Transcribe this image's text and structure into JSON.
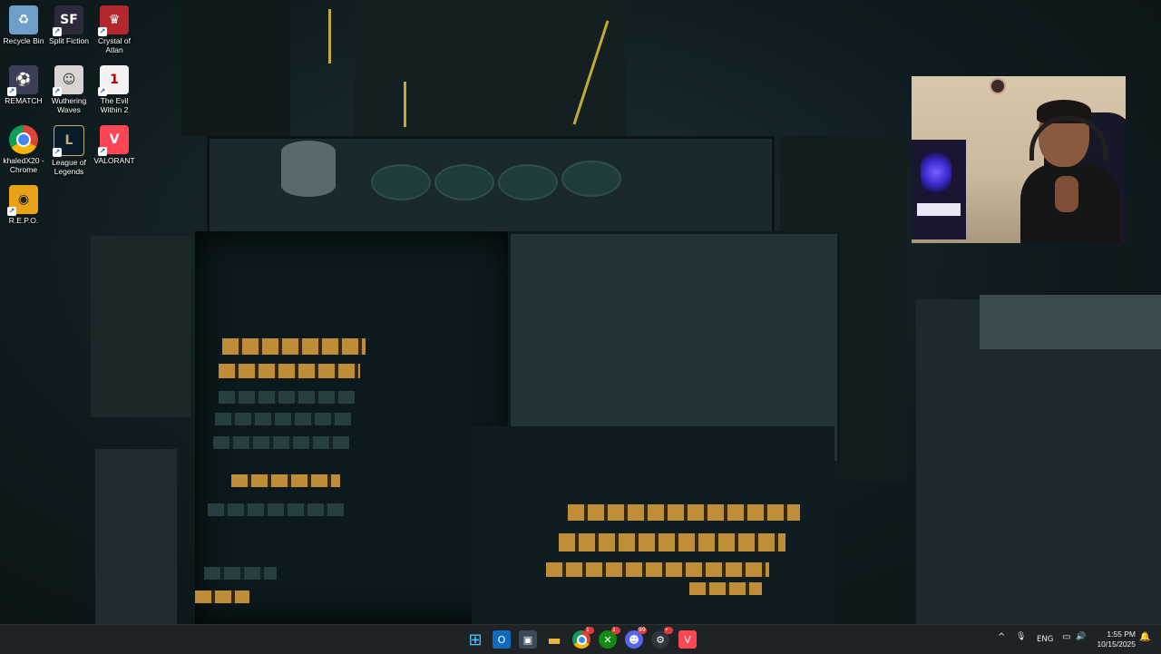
{
  "desktop_icons": [
    {
      "label": "Recycle Bin",
      "icon": "recycle-bin-icon",
      "color": "#6f9fc9",
      "glyph": "♻"
    },
    {
      "label": "Split Fiction",
      "icon": "split-fiction-icon",
      "color": "#2a2a3a",
      "glyph": "SF"
    },
    {
      "label": "Crystal of Atlan",
      "icon": "crystal-of-atlan-icon",
      "color": "#b3282d",
      "glyph": "♛"
    },
    {
      "label": "REMATCH",
      "icon": "rematch-icon",
      "color": "#3a3f55",
      "glyph": "⚽"
    },
    {
      "label": "Wuthering Waves",
      "icon": "wuthering-waves-icon",
      "color": "#d8d4d2",
      "glyph": "☺"
    },
    {
      "label": "The Evil Within 2",
      "icon": "evil-within-2-icon",
      "color": "#f2f2f2",
      "glyph": "1"
    },
    {
      "label": "khaledX20 - Chrome",
      "icon": "chrome-icon",
      "color": "#dd4b39",
      "glyph": "●"
    },
    {
      "label": "League of Legends",
      "icon": "league-of-legends-icon",
      "color": "#0a1c2a",
      "glyph": "L"
    },
    {
      "label": "VALORANT",
      "icon": "valorant-icon",
      "color": "#ff4655",
      "glyph": "V"
    },
    {
      "label": "R.E.P.O.",
      "icon": "repo-icon",
      "color": "#e7a21a",
      "glyph": "◉"
    }
  ],
  "taskbar": {
    "apps": [
      {
        "name": "start-button",
        "icon": "windows-start-icon",
        "color": "#2a8ae6",
        "glyph": "⊞",
        "badge": ""
      },
      {
        "name": "outlook-taskbar-button",
        "icon": "outlook-icon",
        "color": "#0f6cbd",
        "glyph": "O",
        "badge": ""
      },
      {
        "name": "store-taskbar-button",
        "icon": "microsoft-store-icon",
        "color": "#3b4a56",
        "glyph": "▣",
        "badge": ""
      },
      {
        "name": "file-explorer-taskbar-button",
        "icon": "file-explorer-icon",
        "color": "#e8b83a",
        "glyph": "▬",
        "badge": ""
      },
      {
        "name": "chrome-taskbar-button",
        "icon": "chrome-icon",
        "color": "#3a9a4a",
        "glyph": "●",
        "badge": "1"
      },
      {
        "name": "xbox-taskbar-button",
        "icon": "xbox-icon",
        "color": "#138a13",
        "glyph": "✕",
        "badge": "1"
      },
      {
        "name": "discord-taskbar-button",
        "icon": "discord-icon",
        "color": "#5865f2",
        "glyph": "☻",
        "badge": "99"
      },
      {
        "name": "steam-taskbar-button",
        "icon": "steam-icon",
        "color": "#30353a",
        "glyph": "⚙",
        "badge": "•"
      },
      {
        "name": "valorant-taskbar-button",
        "icon": "valorant-icon",
        "color": "#ff4655",
        "glyph": "V",
        "badge": ""
      }
    ],
    "tray": {
      "chevron": "^",
      "mic": "🎙",
      "language": "ENG",
      "network": "▭",
      "volume": "🔊",
      "battery": "▯",
      "time": "1:55 PM",
      "date": "10/15/2025",
      "notification": "🔔"
    }
  }
}
